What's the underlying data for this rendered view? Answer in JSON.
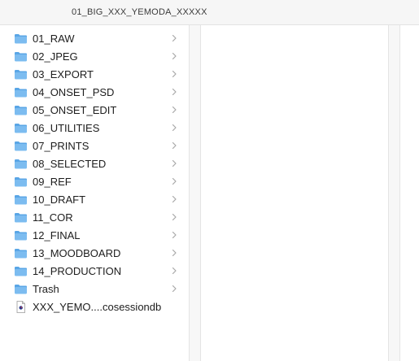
{
  "column_header": {
    "title": "01_BIG_XXX_YEMODA_XXXXX"
  },
  "colors": {
    "folder": "#7cbcf0",
    "folder_tab": "#5aa6e6",
    "chevron": "#a8a8a8"
  },
  "items": [
    {
      "label": "01_RAW",
      "kind": "folder",
      "icon": "folder-icon",
      "has_children": true
    },
    {
      "label": "02_JPEG",
      "kind": "folder",
      "icon": "folder-icon",
      "has_children": true
    },
    {
      "label": "03_EXPORT",
      "kind": "folder",
      "icon": "folder-icon",
      "has_children": true
    },
    {
      "label": "04_ONSET_PSD",
      "kind": "folder",
      "icon": "folder-icon",
      "has_children": true
    },
    {
      "label": "05_ONSET_EDIT",
      "kind": "folder",
      "icon": "folder-icon",
      "has_children": true
    },
    {
      "label": "06_UTILITIES",
      "kind": "folder",
      "icon": "folder-icon",
      "has_children": true
    },
    {
      "label": "07_PRINTS",
      "kind": "folder",
      "icon": "folder-icon",
      "has_children": true
    },
    {
      "label": "08_SELECTED",
      "kind": "folder",
      "icon": "folder-icon",
      "has_children": true
    },
    {
      "label": "09_REF",
      "kind": "folder",
      "icon": "folder-icon",
      "has_children": true
    },
    {
      "label": "10_DRAFT",
      "kind": "folder",
      "icon": "folder-icon",
      "has_children": true
    },
    {
      "label": "11_COR",
      "kind": "folder",
      "icon": "folder-icon",
      "has_children": true
    },
    {
      "label": "12_FINAL",
      "kind": "folder",
      "icon": "folder-icon",
      "has_children": true
    },
    {
      "label": "13_MOODBOARD",
      "kind": "folder",
      "icon": "folder-icon",
      "has_children": true
    },
    {
      "label": "14_PRODUCTION",
      "kind": "folder",
      "icon": "folder-icon",
      "has_children": true
    },
    {
      "label": "Trash",
      "kind": "folder",
      "icon": "folder-icon",
      "has_children": true
    },
    {
      "label": "XXX_YEMO....cosessiondb",
      "kind": "document",
      "icon": "session-file-icon",
      "has_children": false
    }
  ]
}
